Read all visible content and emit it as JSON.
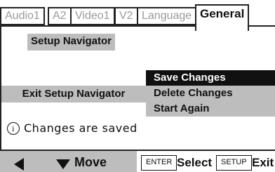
{
  "tabs": [
    {
      "label": "Audio1"
    },
    {
      "label": "A2"
    },
    {
      "label": "Video1"
    },
    {
      "label": "V2"
    },
    {
      "label": "Language"
    },
    {
      "label": "General"
    }
  ],
  "active_tab": "General",
  "section": {
    "title": "Setup Navigator"
  },
  "menu": {
    "left_item": "Exit Setup Navigator",
    "options": [
      {
        "label": "Save Changes",
        "selected": true
      },
      {
        "label": "Delete Changes",
        "selected": false
      },
      {
        "label": "Start Again",
        "selected": false
      }
    ]
  },
  "status": {
    "icon": "info-icon",
    "icon_glyph": "i",
    "text": "Changes are saved"
  },
  "footer": {
    "back_icon": "left-arrow-icon",
    "move_icon": "down-arrow-icon",
    "move_label": "Move",
    "enter_key": "ENTER",
    "enter_action": "Select",
    "setup_key": "SETUP",
    "setup_action": "Exit"
  },
  "colors": {
    "highlight": "#111111",
    "panel_grey": "#bdbdbd",
    "inactive_tab_text": "#9a9a9a"
  }
}
